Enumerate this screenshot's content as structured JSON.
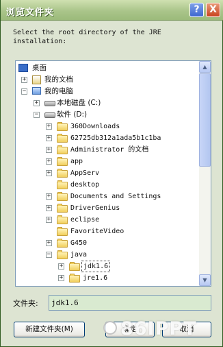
{
  "dialog": {
    "title": "浏览文件夹",
    "help_glyph": "?",
    "close_glyph": "X",
    "instruction": "Select the root directory of the JRE\ninstallation:"
  },
  "tree": {
    "desktop": "桌面",
    "my_docs": "我的文档",
    "my_computer": "我的电脑",
    "local_disk_c": "本地磁盘 (C:)",
    "software_d": "软件 (D:)",
    "d_children": [
      "360Downloads",
      "62725db312a1ada5b1c1ba",
      "Administrator 的文档",
      "app",
      "AppServ",
      "desktop",
      "Documents and Settings",
      "DriverGenius",
      "eclipse",
      "FavoriteVideo",
      "G450",
      "java"
    ],
    "java_children": [
      "jdk1.6",
      "jre1.6"
    ],
    "selected": "jdk1.6",
    "expand_plus": "+",
    "expand_minus": "−",
    "scroll_up": "▲",
    "scroll_down": "▼"
  },
  "folder_field": {
    "label": "文件夹:",
    "value": "jdk1.6"
  },
  "buttons": {
    "new_folder": "新建文件夹(M)",
    "ok": "确定",
    "cancel": "取消"
  },
  "watermark": "86IPPT"
}
